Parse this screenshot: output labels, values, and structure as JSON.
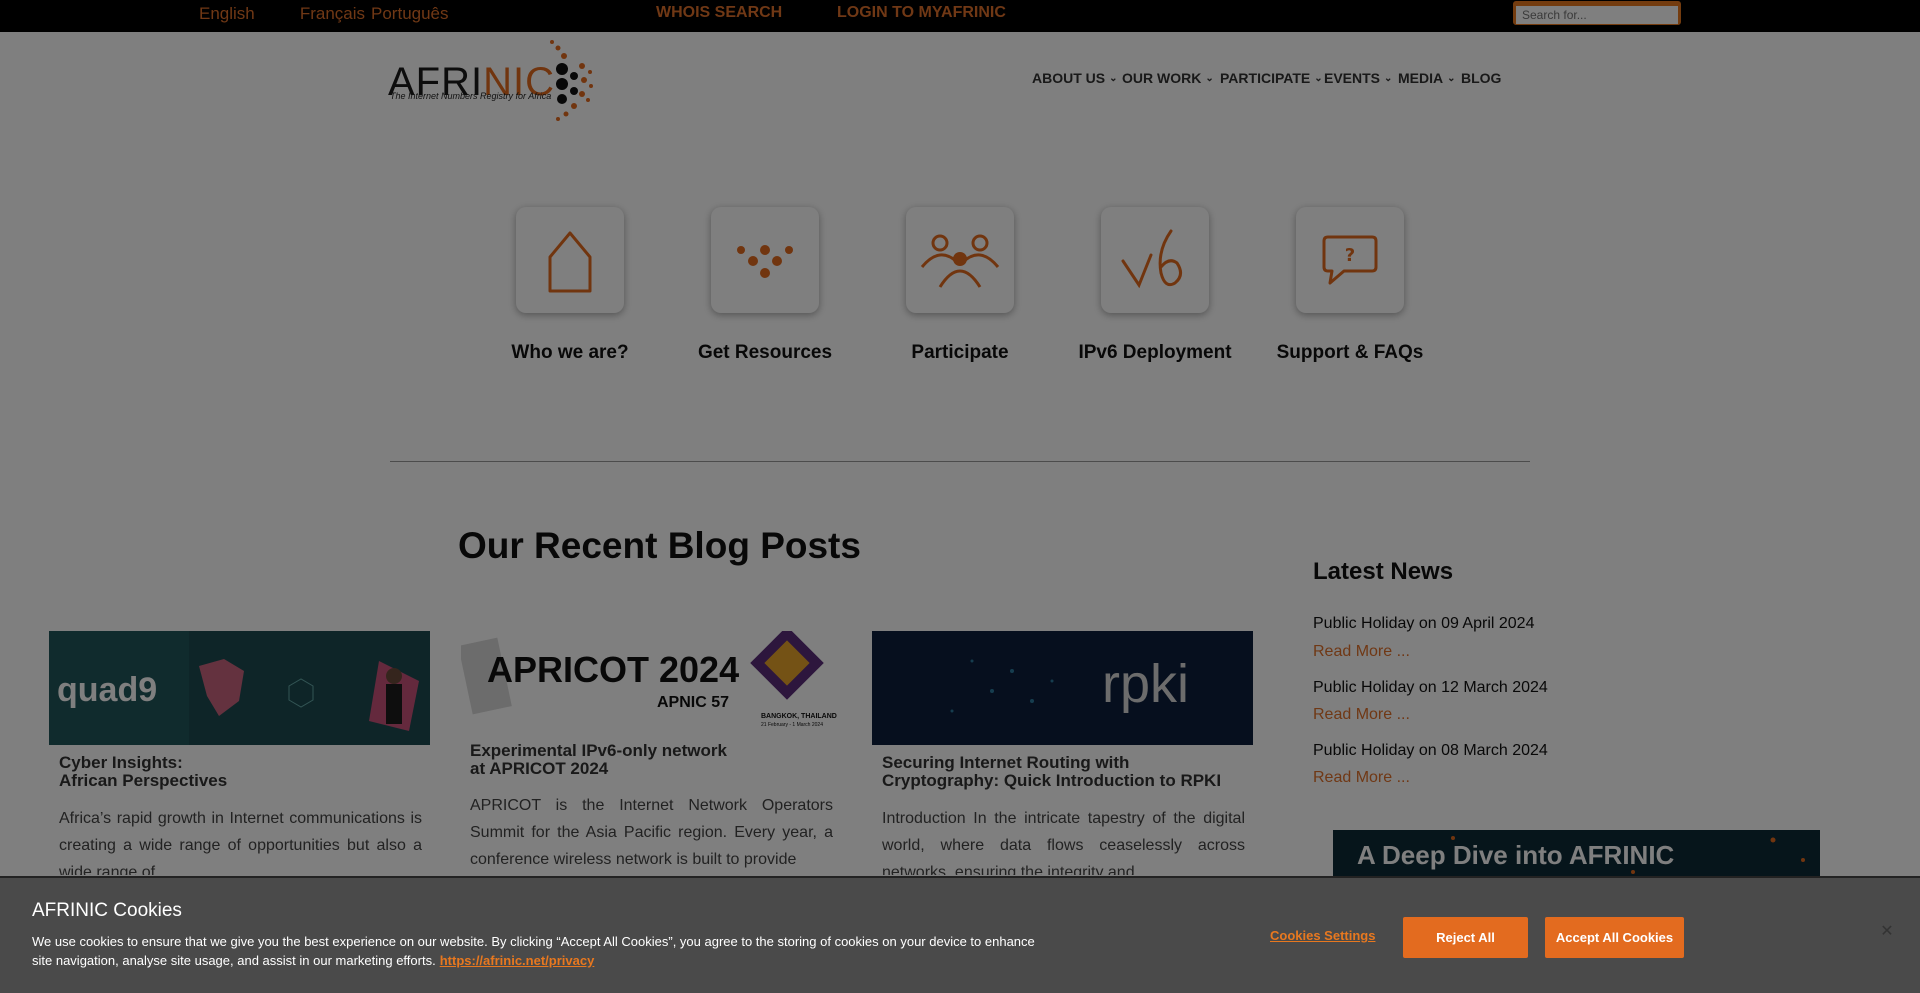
{
  "topbar": {
    "languages": [
      "English",
      "       ",
      "Français",
      "Português"
    ],
    "whois_label": "WHOIS SEARCH",
    "login_label": "LOGIN TO MYAFRINIC",
    "search_placeholder": "Search for..."
  },
  "logo": {
    "word_dark": "AFRI",
    "word_orange": "NIC",
    "tagline": "The Internet Numbers Registry for Africa"
  },
  "nav": {
    "items": [
      "ABOUT US",
      "OUR WORK",
      "PARTICIPATE",
      "EVENTS",
      "MEDIA",
      "BLOG"
    ]
  },
  "tiles": [
    {
      "label": "Who we are?",
      "icon": "house-icon"
    },
    {
      "label": "Get Resources",
      "icon": "dots-triangle-icon"
    },
    {
      "label": "Participate",
      "icon": "people-icon"
    },
    {
      "label": "IPv6 Deployment",
      "icon": "v6-icon"
    },
    {
      "label": "Support & FAQs",
      "icon": "question-bubble-icon"
    }
  ],
  "blog": {
    "title": "Our Recent Blog Posts",
    "posts": [
      {
        "image_caption": "quad9",
        "title_line1": "Cyber Insights:",
        "title_line2": "African Perspectives",
        "excerpt": "Africa’s rapid growth in Internet communications is creating a wide range of opportunities but also a wide range of"
      },
      {
        "image_caption": "APRICOT 2024",
        "image_sub": "APNIC 57",
        "image_place": "BANGKOK, THAILAND",
        "image_dates": "21 February - 1 March 2024",
        "title_line1": "Experimental IPv6-only network",
        "title_line2": "at APRICOT 2024",
        "excerpt": "APRICOT is the Internet Network Operators Summit for the Asia Pacific region. Every year, a conference wireless network is built to provide"
      },
      {
        "image_caption": "rpki",
        "title_line1": "Securing Internet Routing with",
        "title_line2": "Cryptography: Quick Introduction to RPKI",
        "excerpt": "Introduction In the intricate tapestry of the digital world, where data flows ceaselessly across networks, ensuring the integrity and"
      }
    ]
  },
  "news": {
    "title": "Latest News",
    "items": [
      {
        "title": "Public Holiday on 09 April 2024",
        "more": "Read More ..."
      },
      {
        "title": "Public Holiday on 12 March 2024",
        "more": "Read More ..."
      },
      {
        "title": "Public Holiday on 08 March 2024",
        "more": "Read More ..."
      }
    ],
    "banner": "A Deep Dive into AFRINIC"
  },
  "cookie": {
    "title": "AFRINIC Cookies",
    "text": "We use cookies to ensure that we give you the best experience on our website. By clicking “Accept All Cookies”, you agree to the storing of cookies on your device to enhance site navigation, analyse site usage, and assist in our marketing efforts.",
    "link": "https://afrinic.net/privacy",
    "settings_label": "Cookies Settings",
    "reject_label": "Reject All",
    "accept_label": "Accept All Cookies"
  },
  "colors": {
    "accent": "#e36b1f",
    "overlay": "rgba(0,0,0,0.5)",
    "cookie_bg": "#4a4a4a"
  }
}
